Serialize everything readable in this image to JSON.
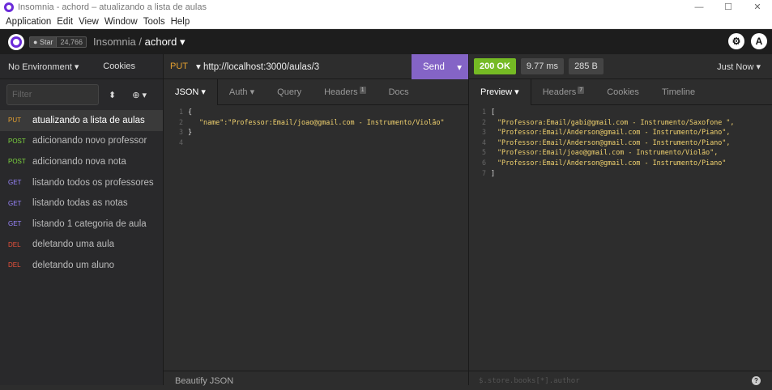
{
  "window": {
    "title": "Insomnia - achord – atualizando a lista de aulas",
    "minimize": "—",
    "maximize": "☐",
    "close": "✕"
  },
  "menu": [
    "Application",
    "Edit",
    "View",
    "Window",
    "Tools",
    "Help"
  ],
  "header": {
    "star_label": "Star",
    "star_count": "24,766",
    "app": "Insomnia",
    "separator": "/",
    "workspace": "achord",
    "caret": "▾"
  },
  "sidebar": {
    "environment": "No Environment ▾",
    "cookies": "Cookies",
    "filter_placeholder": "Filter",
    "requests": [
      {
        "method": "PUT",
        "method_color": "#e4a030",
        "name": "atualizando a lista de aulas",
        "active": true
      },
      {
        "method": "POST",
        "method_color": "#7dd53f",
        "name": "adicionando novo professor"
      },
      {
        "method": "POST",
        "method_color": "#7dd53f",
        "name": "adicionando nova nota"
      },
      {
        "method": "GET",
        "method_color": "#9a86ff",
        "name": "listando todos os professores"
      },
      {
        "method": "GET",
        "method_color": "#9a86ff",
        "name": "listando todas as notas"
      },
      {
        "method": "GET",
        "method_color": "#9a86ff",
        "name": "listando 1 categoria de aula"
      },
      {
        "method": "DEL",
        "method_color": "#e8503a",
        "name": "deletando uma aula"
      },
      {
        "method": "DEL",
        "method_color": "#e8503a",
        "name": "deletando um aluno"
      }
    ]
  },
  "request": {
    "method": "PUT",
    "url": "http://localhost:3000/aulas/3",
    "send": "Send",
    "tabs": {
      "json": "JSON ▾",
      "auth": "Auth ▾",
      "query": "Query",
      "headers": "Headers",
      "headers_count": "1",
      "docs": "Docs"
    },
    "body_lines": [
      "{",
      "\"name\":\"Professor:Email/joao@gmail.com - Instrumento/Violão\"",
      "}",
      ""
    ],
    "line_numbers": [
      "1",
      "2",
      "3",
      "4"
    ],
    "beautify": "Beautify JSON"
  },
  "response": {
    "status": "200 OK",
    "time": "9.77 ms",
    "size": "285 B",
    "when": "Just Now ▾",
    "tabs": {
      "preview": "Preview ▾",
      "headers": "Headers",
      "headers_count": "7",
      "cookies": "Cookies",
      "timeline": "Timeline"
    },
    "line_numbers": [
      "1",
      "2",
      "3",
      "4",
      "5",
      "6",
      "7"
    ],
    "open": "[",
    "items": [
      "\"Professora:Email/gabi@gmail.com - Instrumento/Saxofone \",",
      "\"Professor:Email/Anderson@gmail.com - Instrumento/Piano\",",
      "\"Professor:Email/Anderson@gmail.com - Instrumento/Piano\",",
      "\"Professor:Email/joao@gmail.com - Instrumento/Violão\",",
      "\"Professor:Email/Anderson@gmail.com - Instrumento/Piano\""
    ],
    "close": "]",
    "filter_placeholder": "$.store.books[*].author",
    "help": "?"
  }
}
